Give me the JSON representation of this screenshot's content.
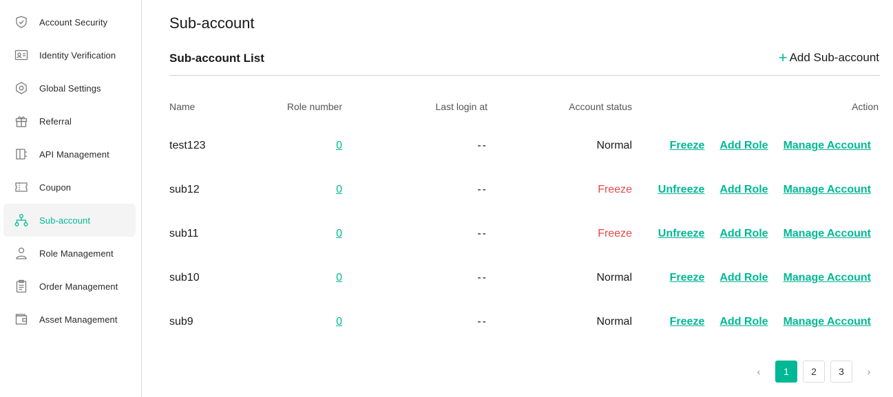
{
  "theme": {
    "accent": "#00b895",
    "danger": "#e8474a"
  },
  "sidebar": {
    "items": [
      {
        "label": "Account Security",
        "icon": "shield-icon",
        "active": false
      },
      {
        "label": "Identity Verification",
        "icon": "id-card-icon",
        "active": false
      },
      {
        "label": "Global Settings",
        "icon": "settings-hex-icon",
        "active": false
      },
      {
        "label": "Referral",
        "icon": "gift-icon",
        "active": false
      },
      {
        "label": "API Management",
        "icon": "api-icon",
        "active": false
      },
      {
        "label": "Coupon",
        "icon": "coupon-icon",
        "active": false
      },
      {
        "label": "Sub-account",
        "icon": "org-chart-icon",
        "active": true
      },
      {
        "label": "Role Management",
        "icon": "user-icon",
        "active": false
      },
      {
        "label": "Order Management",
        "icon": "clipboard-icon",
        "active": false
      },
      {
        "label": "Asset Management",
        "icon": "wallet-icon",
        "active": false
      }
    ]
  },
  "main": {
    "title": "Sub-account",
    "section_title": "Sub-account List",
    "add_button_label": "Add Sub-account",
    "table": {
      "headers": {
        "name": "Name",
        "role_number": "Role number",
        "last_login": "Last login at",
        "status": "Account status",
        "action": "Action"
      },
      "rows": [
        {
          "name": "test123",
          "role_number": "0",
          "last_login": "--",
          "status": "Normal",
          "status_type": "normal",
          "toggle_action": "Freeze",
          "add_role": "Add Role",
          "manage": "Manage Account"
        },
        {
          "name": "sub12",
          "role_number": "0",
          "last_login": "--",
          "status": "Freeze",
          "status_type": "freeze",
          "toggle_action": "Unfreeze",
          "add_role": "Add Role",
          "manage": "Manage Account"
        },
        {
          "name": "sub11",
          "role_number": "0",
          "last_login": "--",
          "status": "Freeze",
          "status_type": "freeze",
          "toggle_action": "Unfreeze",
          "add_role": "Add Role",
          "manage": "Manage Account"
        },
        {
          "name": "sub10",
          "role_number": "0",
          "last_login": "--",
          "status": "Normal",
          "status_type": "normal",
          "toggle_action": "Freeze",
          "add_role": "Add Role",
          "manage": "Manage Account"
        },
        {
          "name": "sub9",
          "role_number": "0",
          "last_login": "--",
          "status": "Normal",
          "status_type": "normal",
          "toggle_action": "Freeze",
          "add_role": "Add Role",
          "manage": "Manage Account"
        }
      ]
    },
    "pagination": {
      "prev": "‹",
      "next": "›",
      "pages": [
        "1",
        "2",
        "3"
      ],
      "current": "1"
    }
  }
}
